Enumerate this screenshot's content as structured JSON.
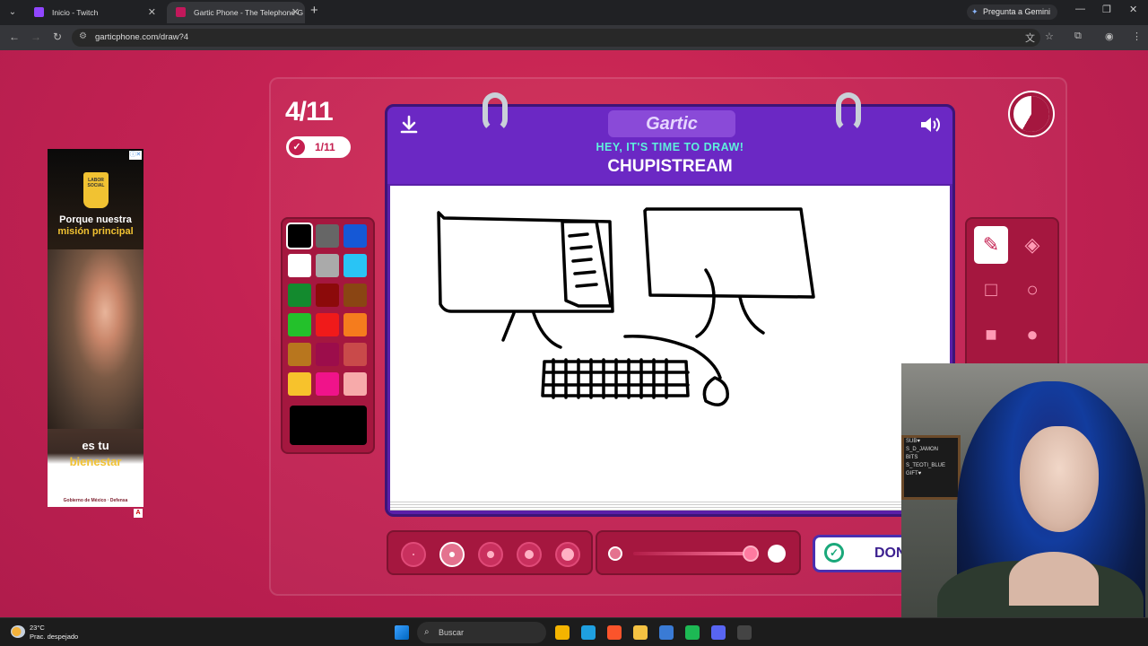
{
  "browser": {
    "tabs": [
      {
        "title": "Inicio - Twitch",
        "favicon_color": "#9146ff"
      },
      {
        "title": "Gartic Phone - The Telephone G",
        "favicon_color": "#c2185b"
      }
    ],
    "gemini_label": "Pregunta a Gemini",
    "url": "garticphone.com/draw?4"
  },
  "game": {
    "round": "4/11",
    "players_done": "1/11",
    "logo": "Gartic",
    "prompt_heading": "HEY, IT'S TIME TO DRAW!",
    "prompt_word": "CHUPISTREAM",
    "done_label": "DONE",
    "palette": [
      "#000000",
      "#666666",
      "#1558d6",
      "#ffffff",
      "#aaaaaa",
      "#29c4f5",
      "#138a2e",
      "#8c0a0a",
      "#8a4513",
      "#23c12b",
      "#f01a1a",
      "#f57c1d",
      "#b8761e",
      "#9c0d4b",
      "#c94a4a",
      "#f7c22c",
      "#f0138a",
      "#f7aaaa"
    ],
    "selected_color": "#000000",
    "tools": [
      "pencil",
      "eraser",
      "rect-outline",
      "circle-outline",
      "rect-filled",
      "circle-filled"
    ],
    "selected_tool": "pencil"
  },
  "ad": {
    "logo_text": "LABOR SOCIAL",
    "line1": "Porque nuestra",
    "line1_highlight": "misión principal",
    "line2": "es tu",
    "line2_highlight": "bienestar",
    "line3": "Labor Social",
    "footer": "Gobierno de México · Defensa"
  },
  "webcam": {
    "board_lines": [
      "SUB♥",
      "S_D_JAMON",
      "BITS",
      "S_TEOTI_BLUE",
      "GIFT♥"
    ]
  },
  "taskbar": {
    "temperature": "23°C",
    "weather": "Prac. despejado",
    "search": "Buscar",
    "apps": [
      {
        "name": "chrome",
        "color": "#f4b400"
      },
      {
        "name": "edge",
        "color": "#1fa0e0"
      },
      {
        "name": "brave",
        "color": "#fb542b"
      },
      {
        "name": "explorer",
        "color": "#f5c242"
      },
      {
        "name": "store",
        "color": "#3a7bd5"
      },
      {
        "name": "spotify",
        "color": "#1db954"
      },
      {
        "name": "discord",
        "color": "#5865f2"
      },
      {
        "name": "obs",
        "color": "#444444"
      }
    ]
  }
}
